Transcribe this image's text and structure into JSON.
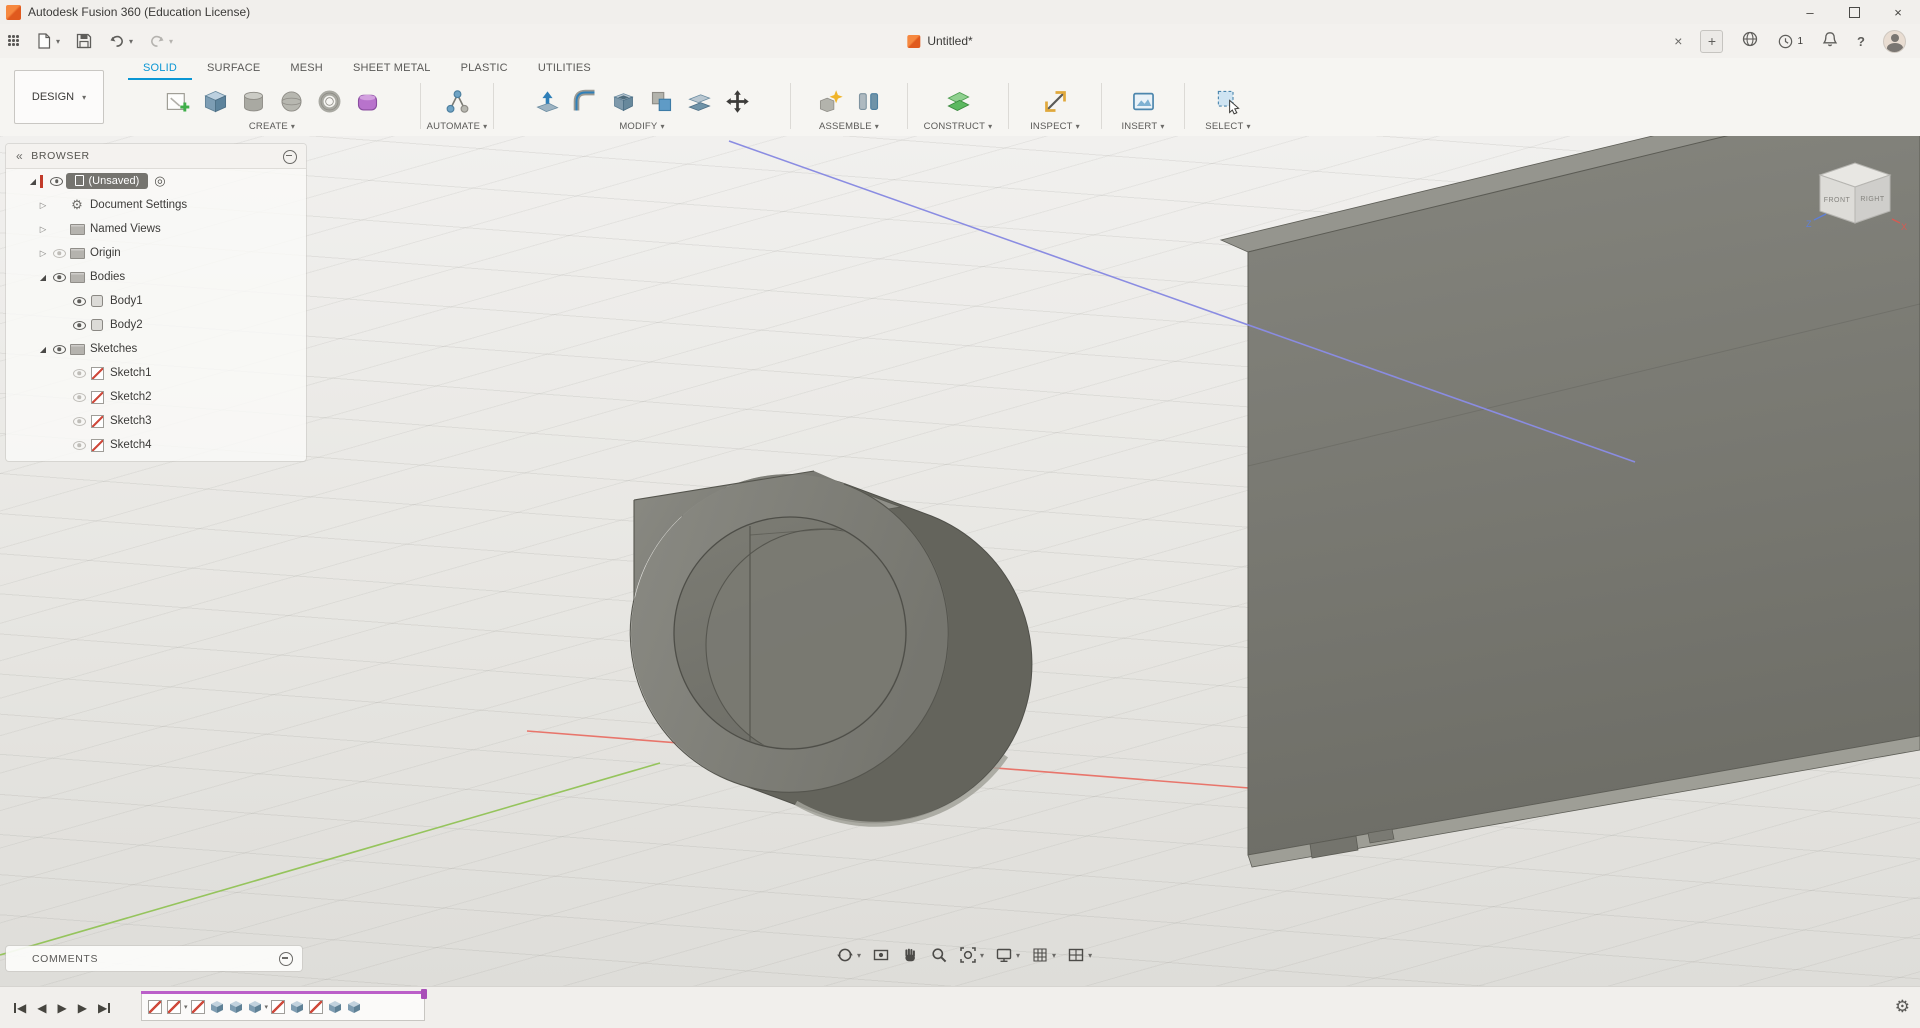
{
  "window": {
    "title": "Autodesk Fusion 360 (Education License)",
    "controls": {
      "minimize": "–",
      "close": "×"
    }
  },
  "qat": {
    "document_tab": "Untitled*",
    "notification_count": "1"
  },
  "toolbar": {
    "workspace": "DESIGN",
    "tabs": [
      "SOLID",
      "SURFACE",
      "MESH",
      "SHEET METAL",
      "PLASTIC",
      "UTILITIES"
    ],
    "active_tab": "SOLID",
    "groups": [
      "CREATE",
      "AUTOMATE",
      "MODIFY",
      "ASSEMBLE",
      "CONSTRUCT",
      "INSPECT",
      "INSERT",
      "SELECT"
    ]
  },
  "browser": {
    "header": "BROWSER",
    "root_label": "(Unsaved)",
    "items": [
      {
        "label": "Document Settings",
        "icon": "gear",
        "expand": "collapsed",
        "eye": "none",
        "indent": 1
      },
      {
        "label": "Named Views",
        "icon": "folder",
        "expand": "collapsed",
        "eye": "none",
        "indent": 1
      },
      {
        "label": "Origin",
        "icon": "folder",
        "expand": "collapsed",
        "eye": "off",
        "indent": 1
      },
      {
        "label": "Bodies",
        "icon": "folder",
        "expand": "expanded",
        "eye": "on",
        "indent": 1
      },
      {
        "label": "Body1",
        "icon": "body",
        "expand": "none",
        "eye": "on",
        "indent": 2
      },
      {
        "label": "Body2",
        "icon": "body",
        "expand": "none",
        "eye": "on",
        "indent": 2
      },
      {
        "label": "Sketches",
        "icon": "folder",
        "expand": "expanded",
        "eye": "on",
        "indent": 1
      },
      {
        "label": "Sketch1",
        "icon": "sketch",
        "expand": "none",
        "eye": "off",
        "indent": 2
      },
      {
        "label": "Sketch2",
        "icon": "sketch",
        "expand": "none",
        "eye": "off",
        "indent": 2
      },
      {
        "label": "Sketch3",
        "icon": "sketch",
        "expand": "none",
        "eye": "off",
        "indent": 2
      },
      {
        "label": "Sketch4",
        "icon": "sketch",
        "expand": "none",
        "eye": "off",
        "indent": 2
      }
    ]
  },
  "viewcube": {
    "front": "FRONT",
    "right": "RIGHT",
    "z": "Z",
    "x": "X"
  },
  "comments": {
    "label": "COMMENTS"
  },
  "timeline": {
    "features": [
      {
        "type": "sketch"
      },
      {
        "type": "sketch",
        "caret": true
      },
      {
        "type": "sketch"
      },
      {
        "type": "extrude"
      },
      {
        "type": "extrude"
      },
      {
        "type": "extrude",
        "caret": true
      },
      {
        "type": "sketch"
      },
      {
        "type": "extrude"
      },
      {
        "type": "sketch"
      },
      {
        "type": "extrude"
      },
      {
        "type": "extrude"
      }
    ]
  },
  "glyphs": {
    "caret_down": "▾",
    "collapse_double": "«",
    "target": "◎",
    "gear": "⚙",
    "step_back": "◀",
    "play_forward": "▶",
    "new_tab_plus": "+",
    "tab_close": "×"
  },
  "accent_colors": {
    "active_tab_blue": "#0a96d4",
    "fusion_orange": "#f26722",
    "timeline_purple": "#bb5fc9",
    "axis_red": "#e8756b",
    "axis_green": "#95c45c",
    "axis_blue": "#8a8ce2"
  }
}
